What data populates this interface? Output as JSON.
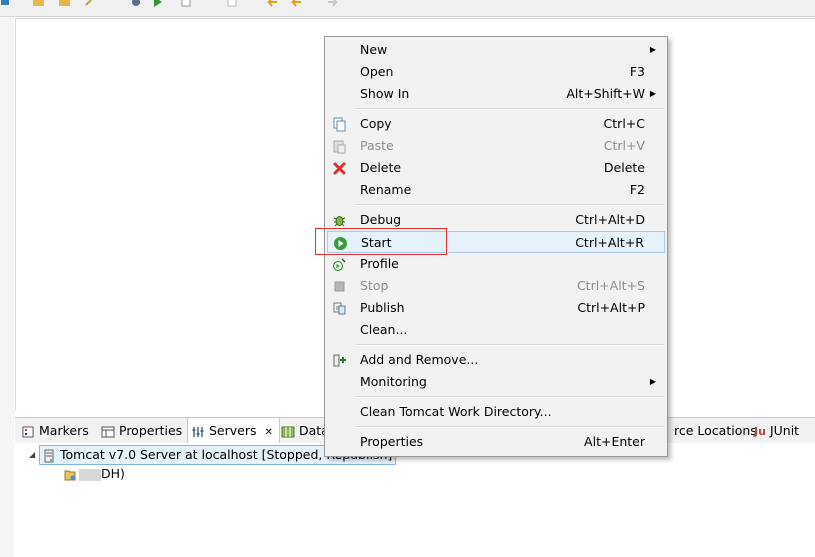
{
  "context_menu": {
    "items": [
      {
        "id": "new",
        "label": "New",
        "shortcut": "",
        "submenu": true,
        "icon": "none",
        "disabled": false
      },
      {
        "id": "open",
        "label": "Open",
        "shortcut": "F3",
        "submenu": false,
        "icon": "none",
        "disabled": false
      },
      {
        "id": "show-in",
        "label": "Show In",
        "shortcut": "Alt+Shift+W",
        "submenu": true,
        "icon": "none",
        "disabled": false
      },
      {
        "id": "copy",
        "label": "Copy",
        "shortcut": "Ctrl+C",
        "submenu": false,
        "icon": "copy-icon",
        "disabled": false
      },
      {
        "id": "paste",
        "label": "Paste",
        "shortcut": "Ctrl+V",
        "submenu": false,
        "icon": "paste-icon",
        "disabled": true
      },
      {
        "id": "delete",
        "label": "Delete",
        "shortcut": "Delete",
        "submenu": false,
        "icon": "delete-icon",
        "disabled": false
      },
      {
        "id": "rename",
        "label": "Rename",
        "shortcut": "F2",
        "submenu": false,
        "icon": "none",
        "disabled": false
      },
      {
        "id": "debug",
        "label": "Debug",
        "shortcut": "Ctrl+Alt+D",
        "submenu": false,
        "icon": "debug-icon",
        "disabled": false
      },
      {
        "id": "start",
        "label": "Start",
        "shortcut": "Ctrl+Alt+R",
        "submenu": false,
        "icon": "start-icon",
        "disabled": false
      },
      {
        "id": "profile",
        "label": "Profile",
        "shortcut": "",
        "submenu": false,
        "icon": "profile-icon",
        "disabled": false
      },
      {
        "id": "stop",
        "label": "Stop",
        "shortcut": "Ctrl+Alt+S",
        "submenu": false,
        "icon": "stop-icon",
        "disabled": true
      },
      {
        "id": "publish",
        "label": "Publish",
        "shortcut": "Ctrl+Alt+P",
        "submenu": false,
        "icon": "publish-icon",
        "disabled": false
      },
      {
        "id": "clean",
        "label": "Clean...",
        "shortcut": "",
        "submenu": false,
        "icon": "none",
        "disabled": false
      },
      {
        "id": "add-remove",
        "label": "Add and Remove...",
        "shortcut": "",
        "submenu": false,
        "icon": "add-remove-icon",
        "disabled": false
      },
      {
        "id": "monitoring",
        "label": "Monitoring",
        "shortcut": "",
        "submenu": true,
        "icon": "none",
        "disabled": false
      },
      {
        "id": "clean-work-dir",
        "label": "Clean Tomcat Work Directory...",
        "shortcut": "",
        "submenu": false,
        "icon": "none",
        "disabled": false
      },
      {
        "id": "properties",
        "label": "Properties",
        "shortcut": "Alt+Enter",
        "submenu": false,
        "icon": "none",
        "disabled": false
      }
    ]
  },
  "views": {
    "tabs": [
      {
        "label": "Markers",
        "icon": "markers-icon"
      },
      {
        "label": "Properties",
        "icon": "properties-icon"
      },
      {
        "label": "Servers",
        "icon": "servers-icon",
        "active": true,
        "close": "✕"
      },
      {
        "label": "Data",
        "icon": "data-icon"
      },
      {
        "label": "rce Locations",
        "icon": "none"
      },
      {
        "label": "JUnit",
        "icon": "junit-icon",
        "icon_text": "Ju"
      }
    ]
  },
  "servers": {
    "tomcat_label": "Tomcat v7.0 Server at localhost  [Stopped, Republish]",
    "child_label": "DH)"
  },
  "colors": {
    "hover": "#e5f1fb",
    "highlight_box": "#e03030",
    "start_icon": "#3b9a3b",
    "delete_icon": "#d9302c"
  }
}
